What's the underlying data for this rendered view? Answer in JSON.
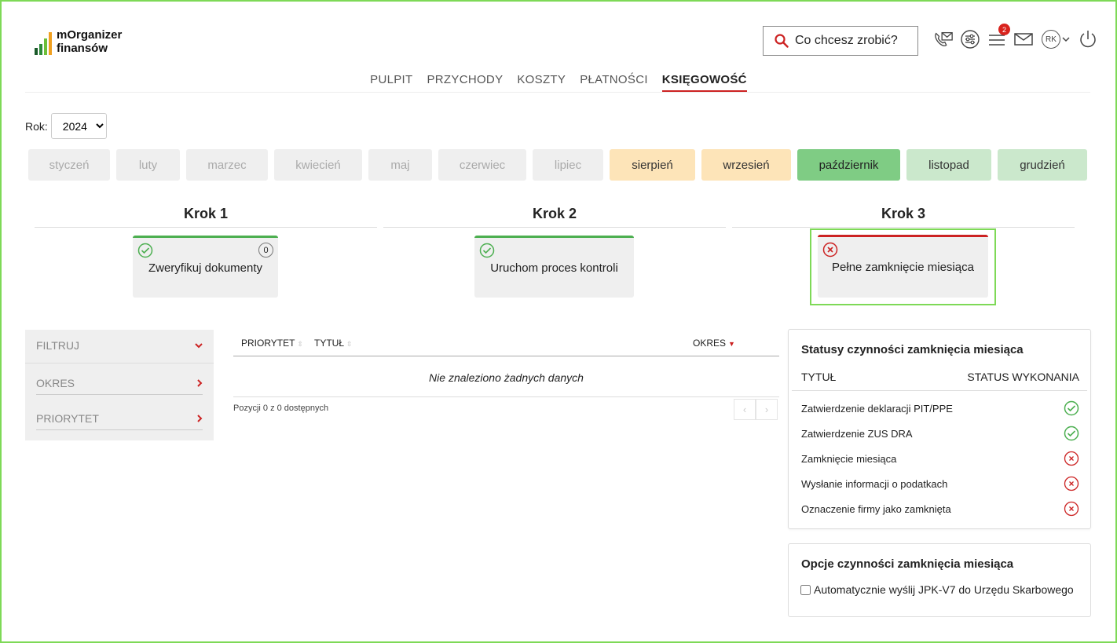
{
  "app": {
    "logo_line1": "mOrganizer",
    "logo_line2": "finansów"
  },
  "header": {
    "search_label": "Co chcesz zrobić?",
    "notifications_count": "2",
    "user_initials": "RK"
  },
  "nav": {
    "tabs": [
      "PULPIT",
      "PRZYCHODY",
      "KOSZTY",
      "PŁATNOŚCI",
      "KSIĘGOWOŚĆ"
    ],
    "active": "KSIĘGOWOŚĆ"
  },
  "year": {
    "label": "Rok:",
    "value": "2024"
  },
  "months": [
    {
      "label": "styczeń",
      "state": "inactive"
    },
    {
      "label": "luty",
      "state": "inactive"
    },
    {
      "label": "marzec",
      "state": "inactive"
    },
    {
      "label": "kwiecień",
      "state": "inactive"
    },
    {
      "label": "maj",
      "state": "inactive"
    },
    {
      "label": "czerwiec",
      "state": "inactive"
    },
    {
      "label": "lipiec",
      "state": "inactive"
    },
    {
      "label": "sierpień",
      "state": "pending"
    },
    {
      "label": "wrzesień",
      "state": "pending"
    },
    {
      "label": "październik",
      "state": "selected"
    },
    {
      "label": "listopad",
      "state": "open"
    },
    {
      "label": "grudzień",
      "state": "open"
    }
  ],
  "steps": [
    {
      "header": "Krok 1",
      "label": "Zweryfikuj dokumenty",
      "status": "ok",
      "count": "0"
    },
    {
      "header": "Krok 2",
      "label": "Uruchom proces kontroli",
      "status": "ok"
    },
    {
      "header": "Krok 3",
      "label": "Pełne zamknięcie miesiąca",
      "status": "error"
    }
  ],
  "filter": {
    "title": "FILTRUJ",
    "items": [
      "OKRES",
      "PRIORYTET"
    ]
  },
  "table": {
    "columns": [
      "PRIORYTET",
      "TYTUŁ",
      "OKRES"
    ],
    "empty_message": "Nie znaleziono żadnych danych",
    "pager_info": "Pozycji 0 z 0 dostępnych",
    "prev": "‹",
    "next": "›"
  },
  "status_box": {
    "title": "Statusy czynności zamknięcia miesiąca",
    "col_title": "TYTUŁ",
    "col_status": "STATUS WYKONANIA",
    "rows": [
      {
        "label": "Zatwierdzenie deklaracji PIT/PPE",
        "status": "done"
      },
      {
        "label": "Zatwierdzenie ZUS DRA",
        "status": "done"
      },
      {
        "label": "Zamknięcie miesiąca",
        "status": "failed"
      },
      {
        "label": "Wysłanie informacji o podatkach",
        "status": "failed"
      },
      {
        "label": "Oznaczenie firmy jako zamknięta",
        "status": "failed"
      }
    ]
  },
  "options_box": {
    "title": "Opcje czynności zamknięcia miesiąca",
    "option_label": "Automatycznie wyślij JPK-V7 do Urzędu Skarbowego",
    "option_checked": false
  },
  "colors": {
    "accent_red": "#cc2222",
    "ok_green": "#4caf50",
    "selected_month": "#7fcc84",
    "pending_month": "#fde4b8",
    "open_month": "#cbe8cc",
    "highlight_frame": "#7ed957"
  }
}
